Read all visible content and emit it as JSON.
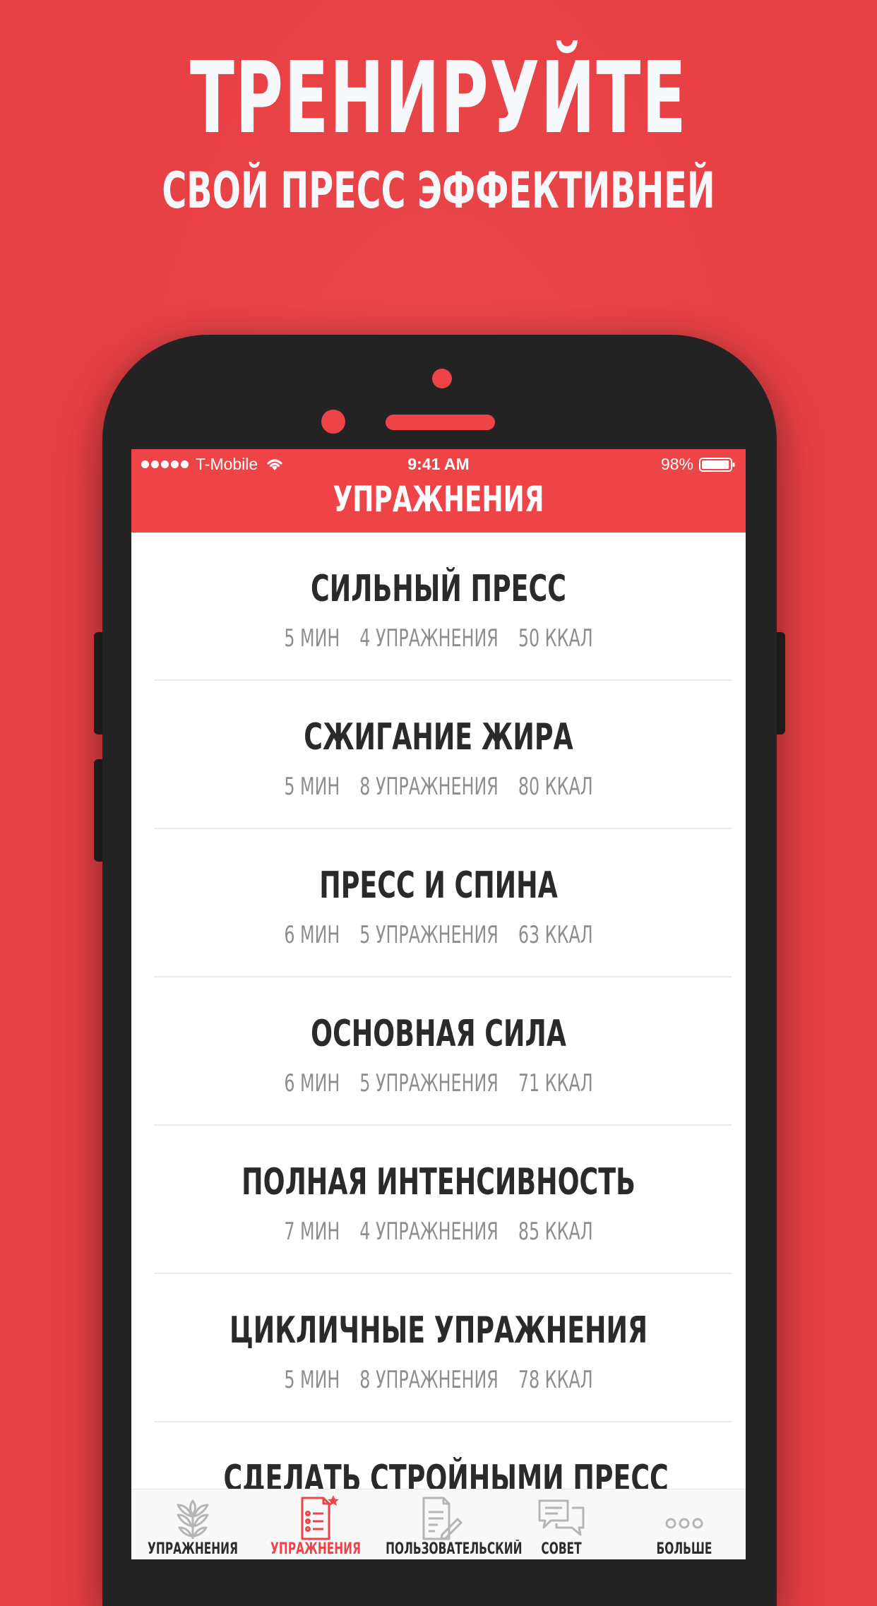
{
  "promo": {
    "headline": "ТРЕНИРУЙТЕ",
    "subheadline": "СВОЙ ПРЕСС ЭФФЕКТИВНЕЙ"
  },
  "status_bar": {
    "carrier": "T-Mobile",
    "time": "9:41 AM",
    "battery": "98%",
    "battery_level": 0.98
  },
  "nav": {
    "title": "УПРАЖНЕНИЯ"
  },
  "workouts": [
    {
      "title": "СИЛЬНЫЙ ПРЕСС",
      "duration": "5 МИН",
      "exercises": "4 УПРАЖНЕНИЯ",
      "calories": "50 ККАЛ"
    },
    {
      "title": "СЖИГАНИЕ ЖИРА",
      "duration": "5 МИН",
      "exercises": "8 УПРАЖНЕНИЯ",
      "calories": "80 ККАЛ"
    },
    {
      "title": "ПРЕСС И СПИНА",
      "duration": "6 МИН",
      "exercises": "5 УПРАЖНЕНИЯ",
      "calories": "63 ККАЛ"
    },
    {
      "title": "ОСНОВНАЯ СИЛА",
      "duration": "6 МИН",
      "exercises": "5 УПРАЖНЕНИЯ",
      "calories": "71 ККАЛ"
    },
    {
      "title": "ПОЛНАЯ ИНТЕНСИВНОСТЬ",
      "duration": "7 МИН",
      "exercises": "4 УПРАЖНЕНИЯ",
      "calories": "85 ККАЛ"
    },
    {
      "title": "ЦИКЛИЧНЫЕ УПРАЖНЕНИЯ",
      "duration": "5 МИН",
      "exercises": "8 УПРАЖНЕНИЯ",
      "calories": "78 ККАЛ"
    },
    {
      "title": "СДЕЛАТЬ СТРОЙНЫМИ ПРЕСС",
      "duration": "",
      "exercises": "",
      "calories": ""
    }
  ],
  "tabs": [
    {
      "label": "УПРАЖНЕНИЯ",
      "icon": "wheat-icon",
      "active": false
    },
    {
      "label": "УПРАЖНЕНИЯ",
      "icon": "checklist-star-icon",
      "active": true
    },
    {
      "label": "ПОЛЬЗОВАТЕЛЬСКИЙ",
      "icon": "document-edit-icon",
      "active": false
    },
    {
      "label": "СОВЕТ",
      "icon": "chat-bubbles-icon",
      "active": false
    },
    {
      "label": "БОЛЬШЕ",
      "icon": "more-dots-icon",
      "active": false
    }
  ],
  "colors": {
    "background": "#E84044",
    "accent": "#EE4448",
    "phone_body": "#232323",
    "title_text": "#2A2A2A",
    "meta_text": "#8E8E8E"
  }
}
